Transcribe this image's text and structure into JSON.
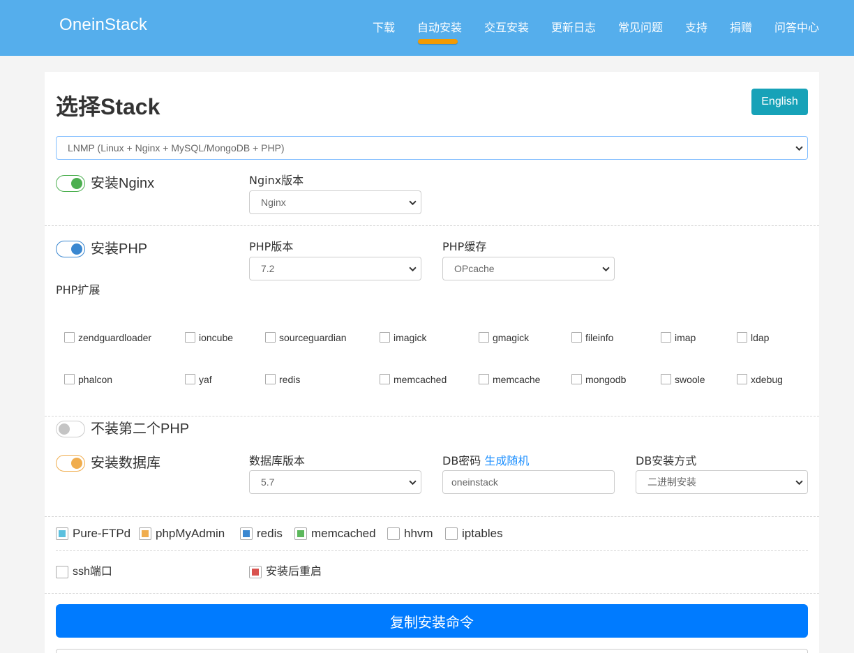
{
  "navbar": {
    "brand": "OneinStack",
    "items": [
      "下载",
      "自动安装",
      "交互安装",
      "更新日志",
      "常见问题",
      "支持",
      "捐赠",
      "问答中心"
    ],
    "active": "自动安装",
    "accent": "#55aeec",
    "active_underline_color": "#f29a02"
  },
  "header": {
    "title": "选择Stack",
    "lang_button": "English"
  },
  "stack_select": {
    "value": "LNMP (Linux + Nginx + MySQL/MongoDB + PHP)"
  },
  "nginx": {
    "toggle_label": "安装Nginx",
    "enabled": true,
    "version_label": "Nginx版本",
    "version_value": "Nginx",
    "color": "#4caf50"
  },
  "php": {
    "toggle_label": "安装PHP",
    "enabled": true,
    "color": "#3a87d0",
    "version_label": "PHP版本",
    "version_value": "7.2",
    "cache_label": "PHP缓存",
    "cache_value": "OPcache",
    "ext_label": "PHP扩展",
    "extensions_row1": [
      "zendguardloader",
      "ioncube",
      "sourceguardian",
      "imagick",
      "gmagick",
      "fileinfo",
      "imap",
      "ldap"
    ],
    "extensions_row2": [
      "phalcon",
      "yaf",
      "redis",
      "memcached",
      "memcache",
      "mongodb",
      "swoole",
      "xdebug"
    ]
  },
  "php2": {
    "toggle_label": "不装第二个PHP",
    "enabled": false
  },
  "db": {
    "toggle_label": "安装数据库",
    "enabled": true,
    "color": "#f0ad4e",
    "version_label": "数据库版本",
    "version_value": "5.7",
    "password_label": "DB密码",
    "generate_link": "生成随机",
    "password_value": "oneinstack",
    "install_method_label": "DB安装方式",
    "install_method_value": "二进制安装"
  },
  "extras": [
    {
      "label": "Pure-FTPd",
      "checked": true,
      "color": "#5bc0de"
    },
    {
      "label": "phpMyAdmin",
      "checked": true,
      "color": "#f0ad4e"
    },
    {
      "label": "redis",
      "checked": true,
      "color": "#3a87d0"
    },
    {
      "label": "memcached",
      "checked": true,
      "color": "#5cb85c"
    },
    {
      "label": "hhvm",
      "checked": false
    },
    {
      "label": "iptables",
      "checked": false
    }
  ],
  "ssh": {
    "label": "ssh端口",
    "checked": false
  },
  "reboot": {
    "label": "安装后重启",
    "checked": true,
    "color": "#d9534f"
  },
  "copy_button": "复制安装命令"
}
